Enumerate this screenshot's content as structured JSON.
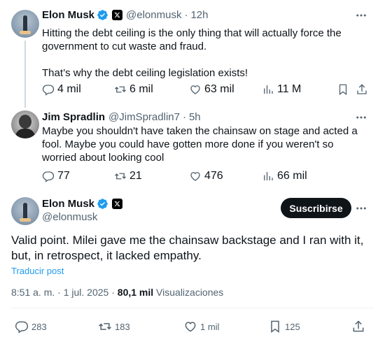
{
  "reply1": {
    "name": "Elon Musk",
    "handle": "@elonmusk",
    "time": "12h",
    "text": "Hitting the debt ceiling is the only thing that will actually force the government to cut waste and fraud.\n\nThat’s why the debt ceiling legislation exists!",
    "replies": "4 mil",
    "reposts": "6 mil",
    "likes": "63 mil",
    "views": "11 M"
  },
  "reply2": {
    "name": "Jim Spradlin",
    "handle": "@JimSpradlin7",
    "time": "5h",
    "text": "Maybe you shouldn't have taken the chainsaw on stage and acted a fool. Maybe you could have gotten more done if you weren't so worried about looking cool",
    "replies": "77",
    "reposts": "21",
    "likes": "476",
    "views": "66 mil"
  },
  "main": {
    "name": "Elon Musk",
    "handle": "@elonmusk",
    "subscribe_label": "Suscribirse",
    "text": "Valid point. Milei gave me the chainsaw backstage and I ran with it, but, in retrospect, it lacked empathy.",
    "translate_label": "Traducir post",
    "time": "8:51 a. m.",
    "date": "1 jul. 2025",
    "views_count": "80,1 mil",
    "views_label": "Visualizaciones",
    "replies": "283",
    "reposts": "183",
    "likes": "1 mil",
    "bookmarks": "125"
  },
  "sep": "·",
  "colors": {
    "verified": "#1d9bf0",
    "text": "#0f1419",
    "muted": "#536471",
    "link": "#1d9bf0"
  }
}
